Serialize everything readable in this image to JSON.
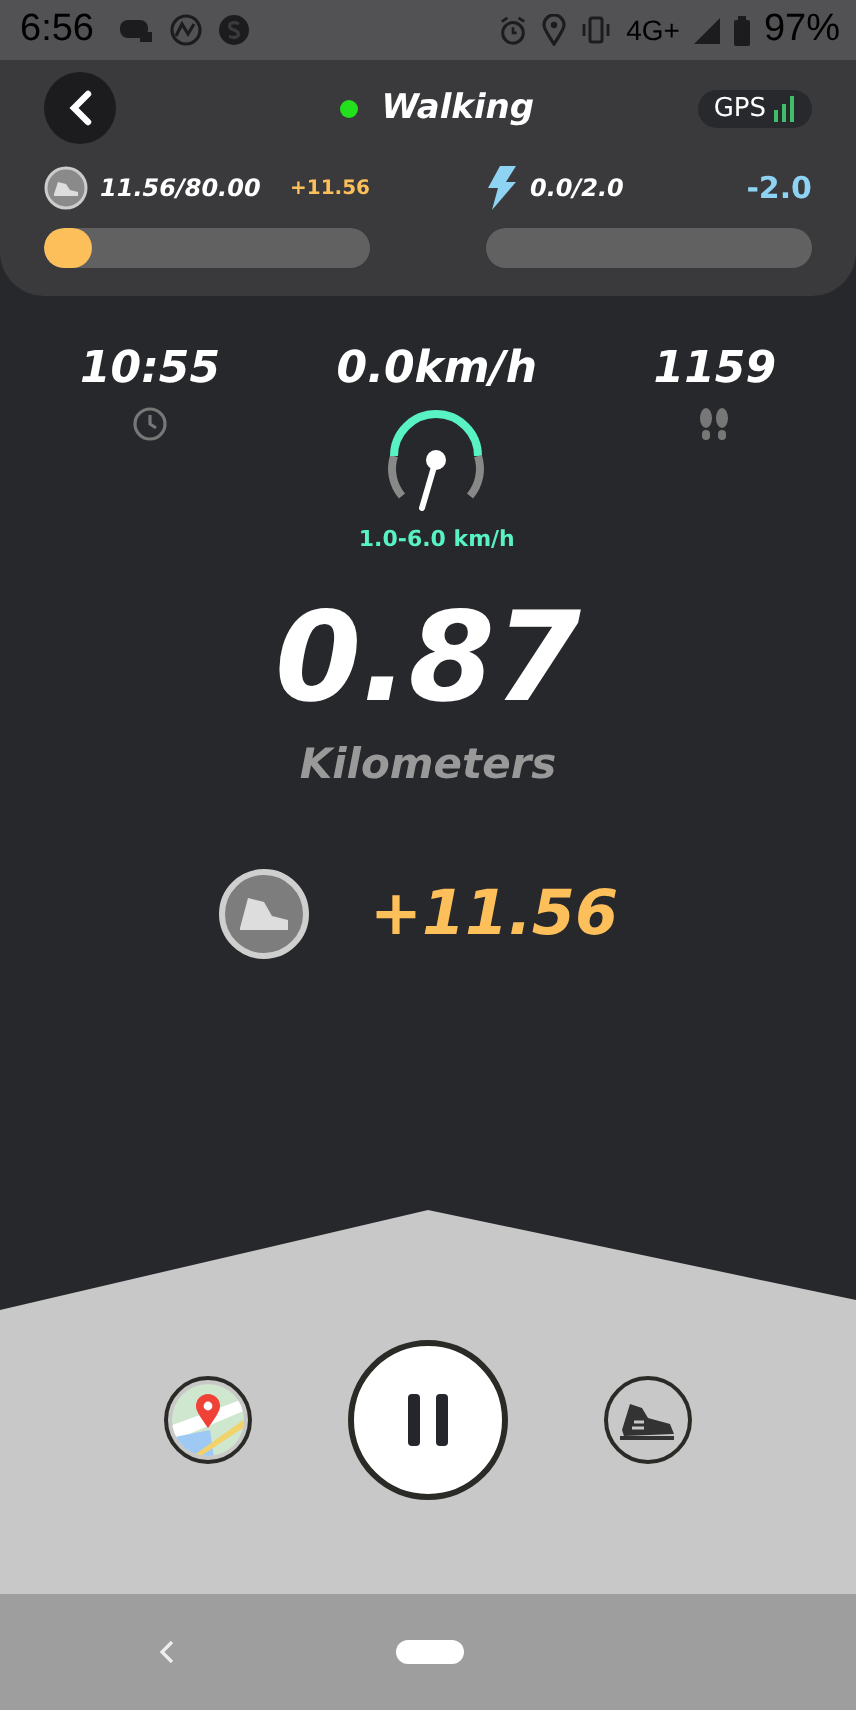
{
  "status_bar": {
    "time": "6:56",
    "network": "4G+",
    "battery": "97%"
  },
  "header": {
    "title": "Walking",
    "active": true,
    "gps": "GPS"
  },
  "meters": [
    {
      "kind": "shoe",
      "reading": "11.56/80.00",
      "change": "+11.56",
      "level": 0.145,
      "color": "#fdbf5a"
    },
    {
      "kind": "energy",
      "reading": "0.0/2.0",
      "change": "-2.0",
      "color": "#8fd3f4"
    }
  ],
  "stats": [
    {
      "kind": "time",
      "value": "10:55"
    },
    {
      "kind": "speed",
      "value": "0.0km/h"
    },
    {
      "kind": "steps",
      "value": "1159"
    }
  ],
  "speed_range": "1.0-6.0 km/h",
  "distance": {
    "value": "0.87",
    "unit": "Kilometers"
  },
  "earned": "+11.56"
}
